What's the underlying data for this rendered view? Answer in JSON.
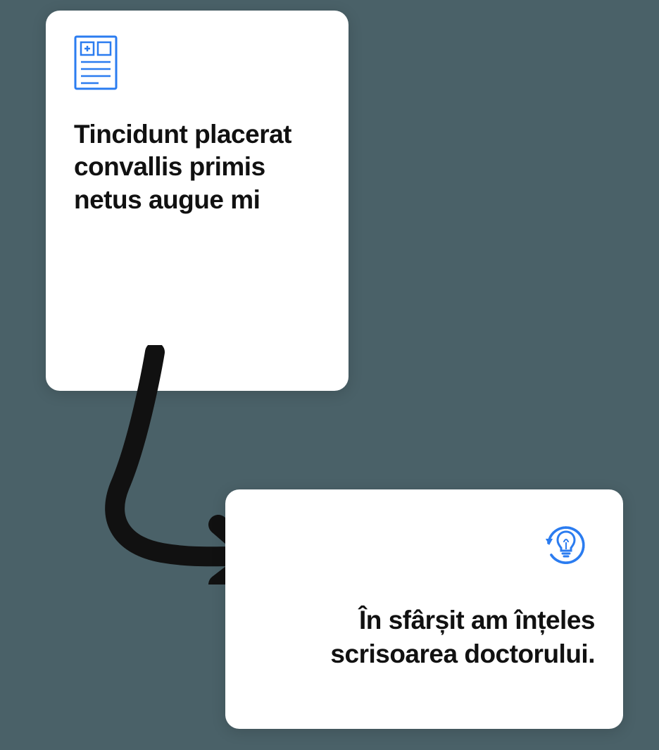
{
  "card1": {
    "title": "Tincidunt placerat convallis primis netus augue mi"
  },
  "card2": {
    "title": "În sfârșit am înțeles scrisoarea doctorului."
  },
  "colors": {
    "icon": "#2b7cf0",
    "arrow": "#111111"
  }
}
